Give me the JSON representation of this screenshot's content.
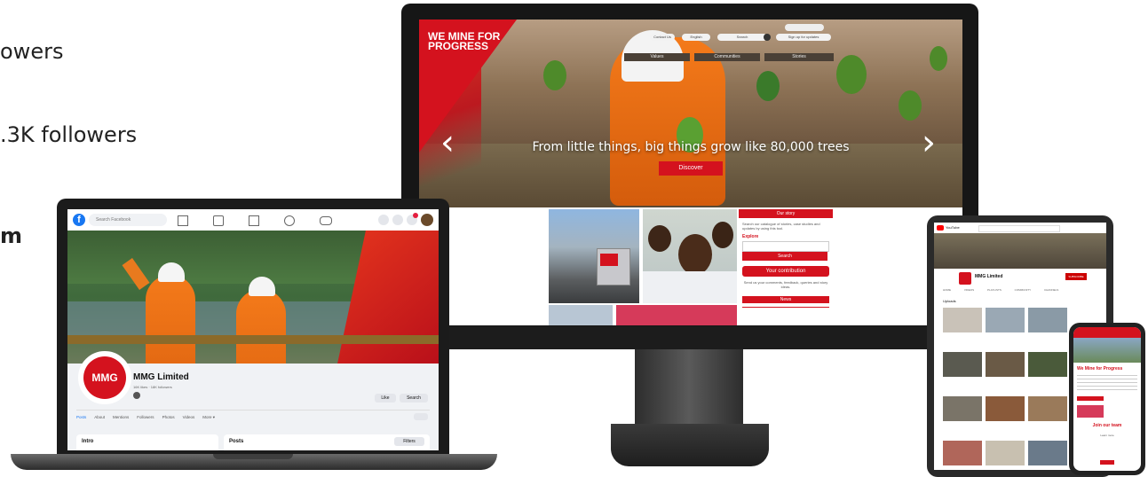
{
  "left_text": {
    "line1": "owers",
    "line2": ".3K followers",
    "line3": "m"
  },
  "monitor": {
    "hero_title": "WE MINE FOR PROGRESS",
    "nav_pills": [
      "Contact Us",
      "English",
      "Search",
      "Sign up for updates"
    ],
    "nav_tabs": [
      "Values",
      "Communities",
      "Stories"
    ],
    "caption": "From little things, big things grow like 80,000 trees",
    "cta": "Discover",
    "side_header": "Our story",
    "side_text": "Search our catalogue of stories, case studies and updates by using this tool.",
    "explore": "Explore",
    "search_btn": "Search",
    "contribution": "Your contribution",
    "contribution_text": "Send us your comments, feedback, queries and story ideas.",
    "news": "News"
  },
  "facebook": {
    "search": "Search Facebook",
    "page_name": "MMG Limited",
    "page_sub": "16K likes · 18K followers",
    "avatar": "MMG",
    "like_btn": "Like",
    "search_btn": "Search",
    "tabs": [
      "Posts",
      "About",
      "Mentions",
      "Followers",
      "Photos",
      "Videos",
      "More ▾"
    ],
    "intro": "Intro",
    "posts": "Posts",
    "filters": "Filters"
  },
  "youtube": {
    "logo": "YouTube",
    "channel": "MMG Limited",
    "subscribe": "SUBSCRIBE",
    "tabs": [
      "HOME",
      "VIDEOS",
      "PLAYLISTS",
      "COMMUNITY",
      "CHANNELS",
      "ABOUT"
    ],
    "section": "Uploads"
  },
  "phone": {
    "title": "We Mine for Progress",
    "join": "Join our team",
    "learn": "Learn more"
  },
  "colors": {
    "brand_red": "#d4121e",
    "fb_blue": "#1877f2"
  }
}
